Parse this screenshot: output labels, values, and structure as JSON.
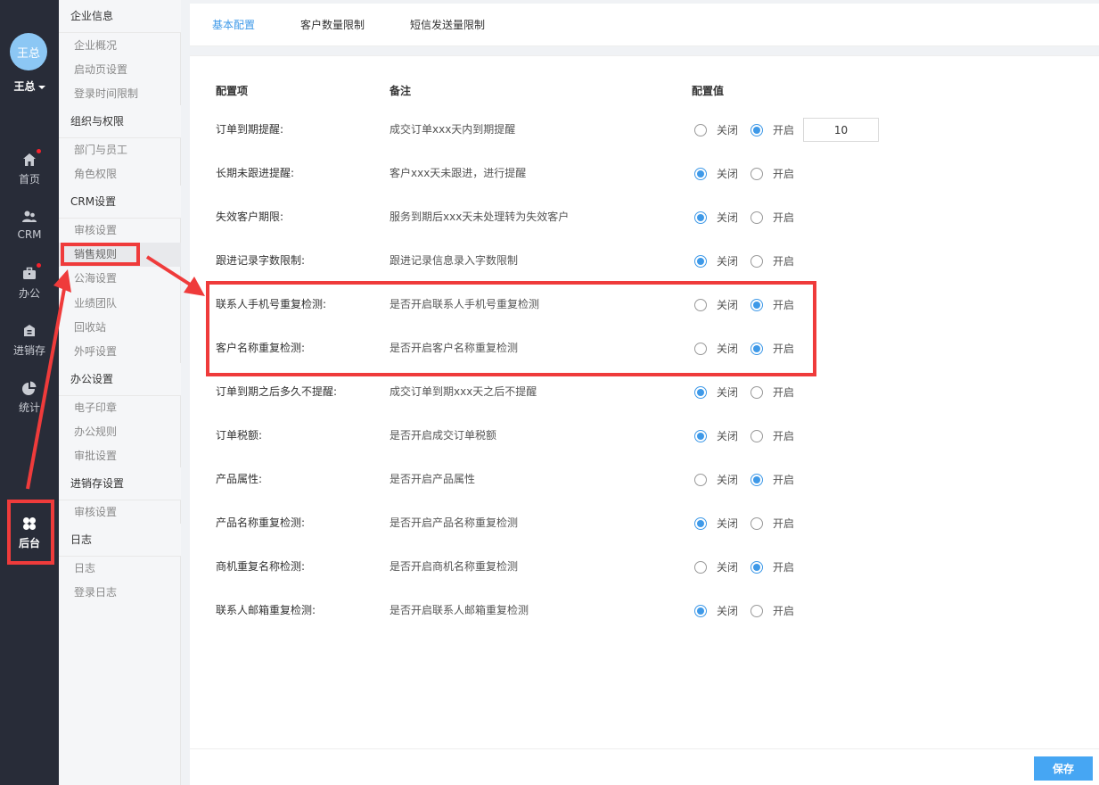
{
  "nav": {
    "avatar_text": "王总",
    "user_name": "王总",
    "items": [
      {
        "label": "首页",
        "icon": "home-icon"
      },
      {
        "label": "CRM",
        "icon": "users-icon"
      },
      {
        "label": "办公",
        "icon": "briefcase-icon"
      },
      {
        "label": "进销存",
        "icon": "inventory-icon"
      },
      {
        "label": "统计",
        "icon": "pie-chart-icon"
      },
      {
        "label": "后台",
        "icon": "clover-icon"
      }
    ]
  },
  "submenu": {
    "groups": [
      {
        "title": "企业信息",
        "items": [
          "企业概况",
          "启动页设置",
          "登录时间限制"
        ]
      },
      {
        "title": "组织与权限",
        "items": [
          "部门与员工",
          "角色权限"
        ]
      },
      {
        "title": "CRM设置",
        "items": [
          "审核设置",
          "销售规则",
          "公海设置",
          "业绩团队",
          "回收站",
          "外呼设置"
        ]
      },
      {
        "title": "办公设置",
        "items": [
          "电子印章",
          "办公规则",
          "审批设置"
        ]
      },
      {
        "title": "进销存设置",
        "items": [
          "审核设置"
        ]
      },
      {
        "title": "日志",
        "items": [
          "日志",
          "登录日志"
        ]
      }
    ]
  },
  "tabs": [
    "基本配置",
    "客户数量限制",
    "短信发送量限制"
  ],
  "table": {
    "headers": [
      "配置项",
      "备注",
      "配置值"
    ],
    "off_label": "关闭",
    "on_label": "开启",
    "rows": [
      {
        "name": "订单到期提醒:",
        "note": "成交订单xxx天内到期提醒",
        "value": "on",
        "input": "10"
      },
      {
        "name": "长期未跟进提醒:",
        "note": "客户xxx天未跟进，进行提醒",
        "value": "off"
      },
      {
        "name": "失效客户期限:",
        "note": "服务到期后xxx天未处理转为失效客户",
        "value": "off"
      },
      {
        "name": "跟进记录字数限制:",
        "note": "跟进记录信息录入字数限制",
        "value": "off"
      },
      {
        "name": "联系人手机号重复检测:",
        "note": "是否开启联系人手机号重复检测",
        "value": "on"
      },
      {
        "name": "客户名称重复检测:",
        "note": "是否开启客户名称重复检测",
        "value": "on"
      },
      {
        "name": "订单到期之后多久不提醒:",
        "note": "成交订单到期xxx天之后不提醒",
        "value": "off"
      },
      {
        "name": "订单税额:",
        "note": "是否开启成交订单税额",
        "value": "off"
      },
      {
        "name": "产品属性:",
        "note": "是否开启产品属性",
        "value": "on"
      },
      {
        "name": "产品名称重复检测:",
        "note": "是否开启产品名称重复检测",
        "value": "off"
      },
      {
        "name": "商机重复名称检测:",
        "note": "是否开启商机名称重复检测",
        "value": "on"
      },
      {
        "name": "联系人邮箱重复检测:",
        "note": "是否开启联系人邮箱重复检测",
        "value": "off"
      }
    ]
  },
  "footer": {
    "save_label": "保存"
  },
  "colors": {
    "accent": "#3e99e8",
    "nav_bg": "#282c38",
    "annotation": "#ef3b3b"
  }
}
